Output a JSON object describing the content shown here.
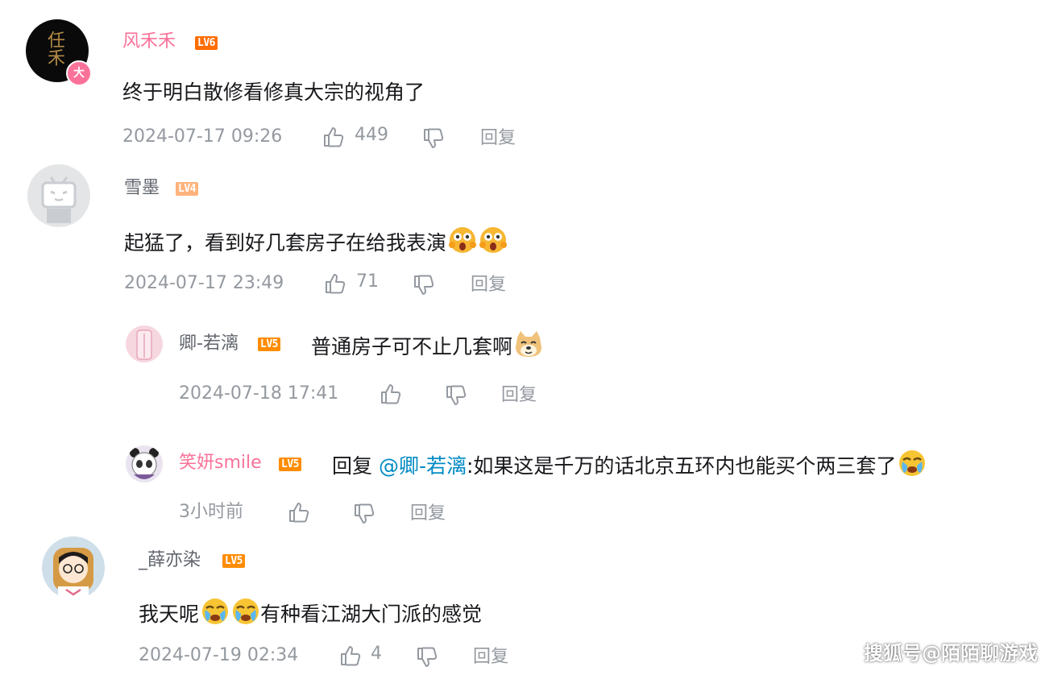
{
  "colors": {
    "username_pink": "#fb7299",
    "username_gray": "#61666d",
    "meta_gray": "#9499a0",
    "mention_blue": "#008ac5",
    "lv6": "#ff6c00",
    "lv5": "#ff8c00",
    "lv4": "#ffb37c"
  },
  "comments": [
    {
      "username": "风禾禾",
      "level": "LV6",
      "content": "终于明白散修看修真大宗的视角了",
      "time": "2024-07-17 09:26",
      "likes": "449",
      "reply_label": "回复",
      "avatar_text": "任禾"
    },
    {
      "username": "雪墨",
      "level": "LV4",
      "content": "起猛了，看到好几套房子在给我表演",
      "time": "2024-07-17 23:49",
      "likes": "71",
      "reply_label": "回复"
    },
    {
      "username": "_薛亦染",
      "level": "LV5",
      "content_a": "我天呢",
      "content_b": "有种看江湖大门派的感觉",
      "time": "2024-07-19 02:34",
      "likes": "4",
      "reply_label": "回复"
    }
  ],
  "replies": [
    {
      "username": "卿-若漓",
      "level": "LV5",
      "content": "普通房子可不止几套啊",
      "time": "2024-07-18 17:41",
      "reply_label": "回复"
    },
    {
      "username": "笑妍smile",
      "level": "LV5",
      "prefix": "回复",
      "mention": "@卿-若漓",
      "content": ":如果这是千万的话北京五环内也能买个两三套了",
      "time": "3小时前",
      "reply_label": "回复"
    }
  ],
  "watermark": "搜狐号@陌陌聊游戏"
}
